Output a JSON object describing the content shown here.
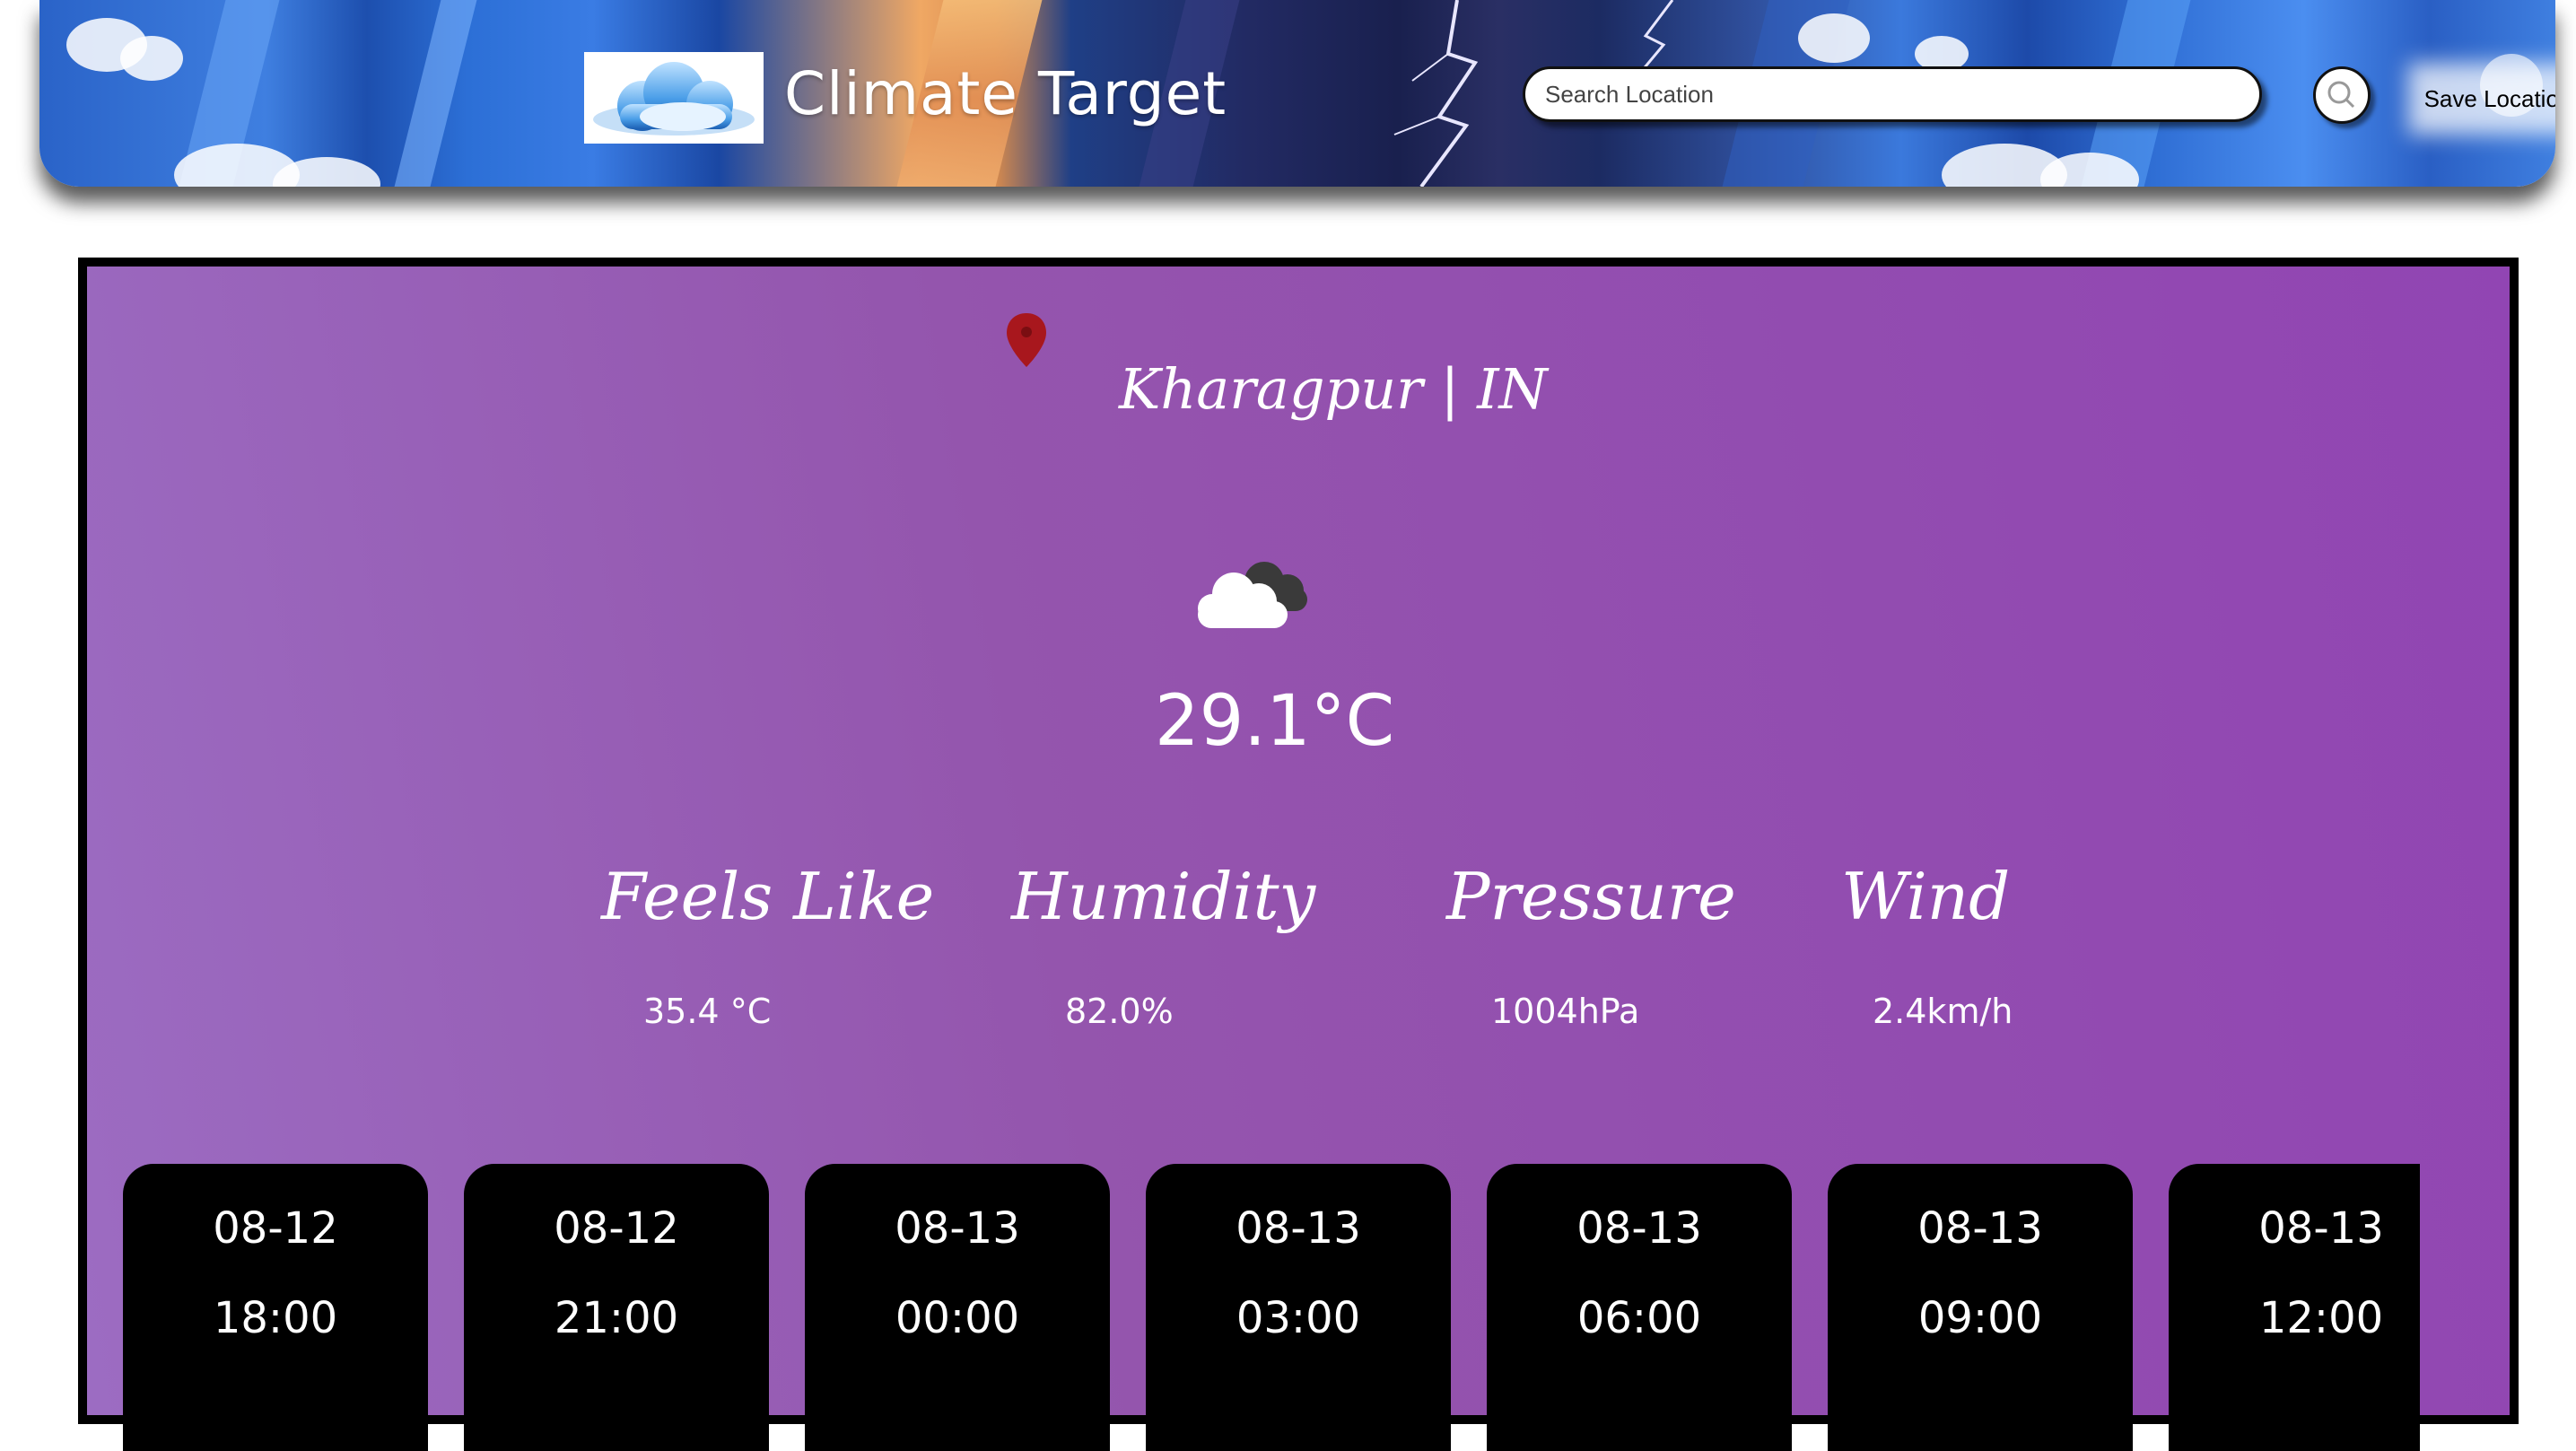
{
  "header": {
    "app_title": "Climate Target",
    "search_placeholder": "Search Location",
    "save_label": "Save Location"
  },
  "current": {
    "location": "Kharagpur | IN",
    "temperature": "29.1°C",
    "condition_icon": "broken-clouds-icon"
  },
  "stats": [
    {
      "label": "Feels Like",
      "value": "35.4 °C"
    },
    {
      "label": "Humidity",
      "value": "82.0%"
    },
    {
      "label": "Pressure",
      "value": "1004hPa"
    },
    {
      "label": "Wind",
      "value": "2.4km/h"
    }
  ],
  "forecast": [
    {
      "date": "08-12",
      "time": "18:00"
    },
    {
      "date": "08-12",
      "time": "21:00"
    },
    {
      "date": "08-13",
      "time": "00:00"
    },
    {
      "date": "08-13",
      "time": "03:00"
    },
    {
      "date": "08-13",
      "time": "06:00"
    },
    {
      "date": "08-13",
      "time": "09:00"
    },
    {
      "date": "08-13",
      "time": "12:00"
    }
  ],
  "colors": {
    "panel_gradient_start": "#9c6cc2",
    "panel_gradient_end": "#9145b3",
    "card_background": "#000000",
    "pin_color": "#a8171d"
  }
}
